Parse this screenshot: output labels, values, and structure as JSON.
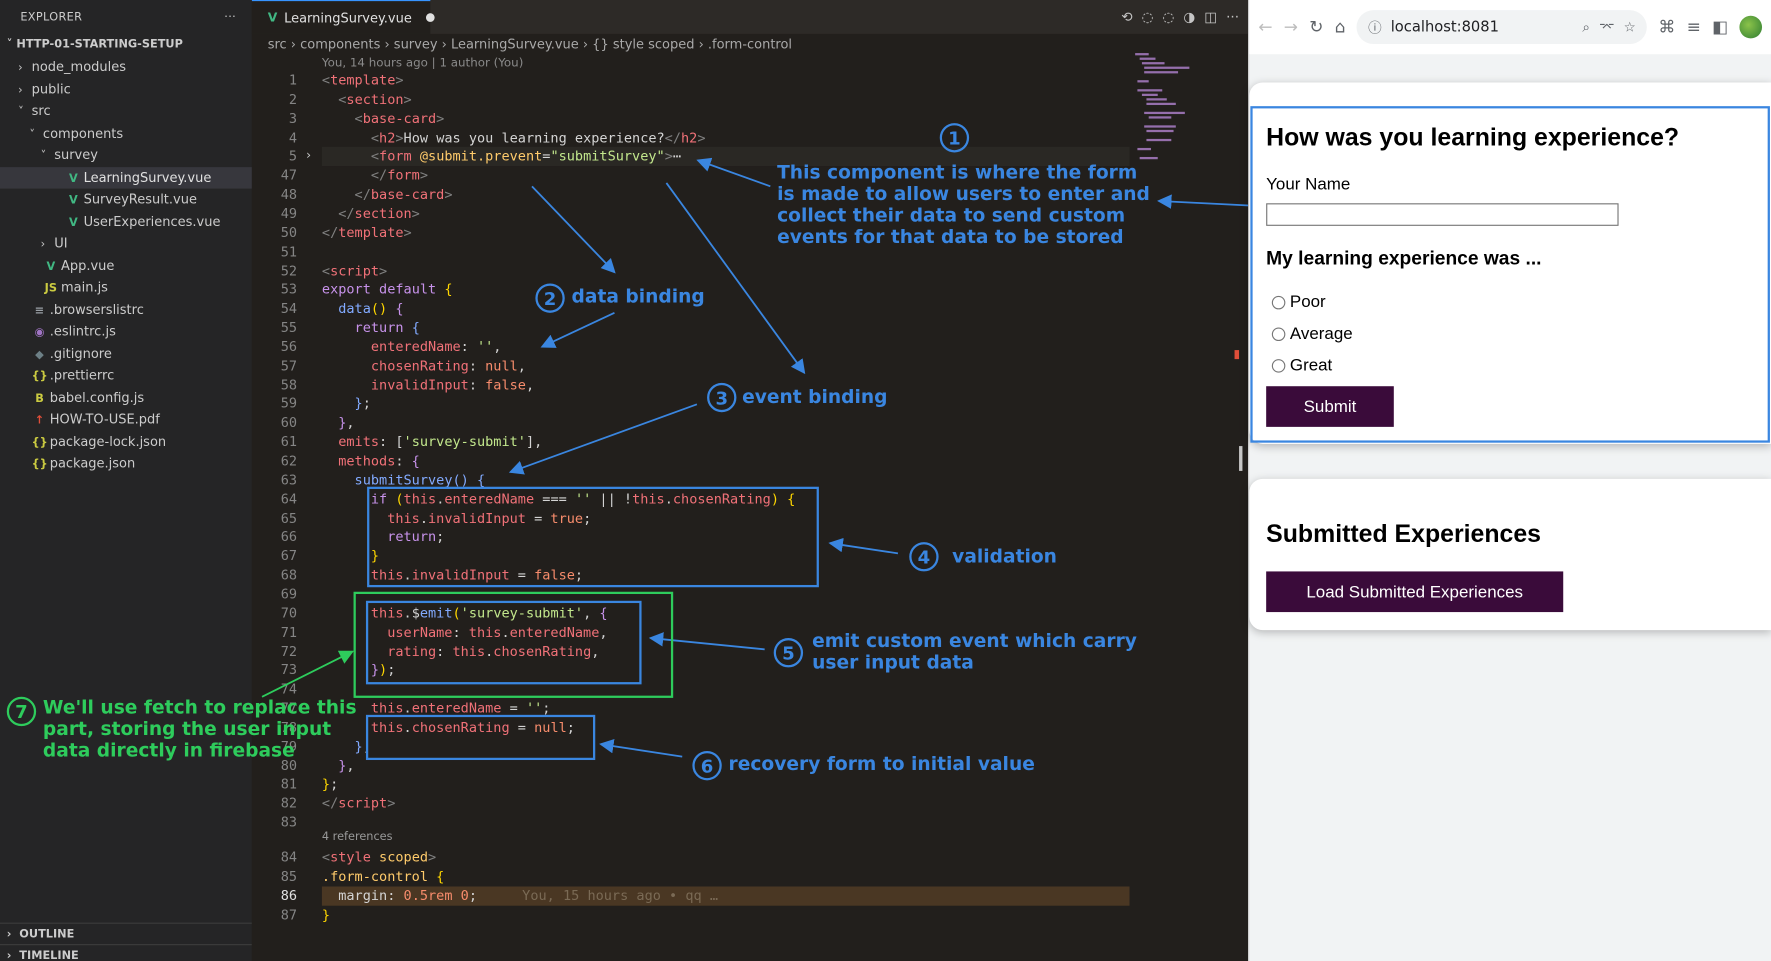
{
  "explorer": {
    "title": "EXPLORER",
    "menu": "···",
    "project": "HTTP-01-STARTING-SETUP",
    "items": [
      {
        "label": "node_modules",
        "indent": 1,
        "chev": "›",
        "icon": "",
        "color": "#cccccc"
      },
      {
        "label": "public",
        "indent": 1,
        "chev": "›",
        "icon": "",
        "color": "#cccccc"
      },
      {
        "label": "src",
        "indent": 1,
        "chev": "˅",
        "icon": "",
        "color": "#cccccc"
      },
      {
        "label": "components",
        "indent": 2,
        "chev": "˅",
        "icon": "",
        "color": "#cccccc"
      },
      {
        "label": "survey",
        "indent": 3,
        "chev": "˅",
        "icon": "",
        "color": "#cccccc"
      },
      {
        "label": "LearningSurvey.vue",
        "indent": 4,
        "chev": "",
        "icon": "V",
        "iconColor": "#41b883",
        "color": "#e0e0e0",
        "selected": true
      },
      {
        "label": "SurveyResult.vue",
        "indent": 4,
        "chev": "",
        "icon": "V",
        "iconColor": "#41b883",
        "color": "#cccccc"
      },
      {
        "label": "UserExperiences.vue",
        "indent": 4,
        "chev": "",
        "icon": "V",
        "iconColor": "#41b883",
        "color": "#cccccc"
      },
      {
        "label": "UI",
        "indent": 3,
        "chev": "›",
        "icon": "",
        "color": "#cccccc"
      },
      {
        "label": "App.vue",
        "indent": 2,
        "chev": "",
        "icon": "V",
        "iconColor": "#41b883",
        "color": "#cccccc"
      },
      {
        "label": "main.js",
        "indent": 2,
        "chev": "",
        "icon": "JS",
        "iconColor": "#cbcb41",
        "color": "#cccccc"
      },
      {
        "label": ".browserslistrc",
        "indent": 1,
        "chev": "",
        "icon": "≡",
        "iconColor": "#9aa0a6",
        "color": "#cccccc"
      },
      {
        "label": ".eslintrc.js",
        "indent": 1,
        "chev": "",
        "icon": "◉",
        "iconColor": "#a074c4",
        "color": "#cccccc"
      },
      {
        "label": ".gitignore",
        "indent": 1,
        "chev": "",
        "icon": "◆",
        "iconColor": "#6d8086",
        "color": "#cccccc"
      },
      {
        "label": ".prettierrc",
        "indent": 1,
        "chev": "",
        "icon": "{}",
        "iconColor": "#cbcb41",
        "color": "#cccccc"
      },
      {
        "label": "babel.config.js",
        "indent": 1,
        "chev": "",
        "icon": "B",
        "iconColor": "#cbcb41",
        "color": "#cccccc"
      },
      {
        "label": "HOW-TO-USE.pdf",
        "indent": 1,
        "chev": "",
        "icon": "↑",
        "iconColor": "#e04e39",
        "color": "#cccccc"
      },
      {
        "label": "package-lock.json",
        "indent": 1,
        "chev": "",
        "icon": "{}",
        "iconColor": "#cbcb41",
        "color": "#cccccc"
      },
      {
        "label": "package.json",
        "indent": 1,
        "chev": "",
        "icon": "{}",
        "iconColor": "#cbcb41",
        "color": "#cccccc"
      }
    ],
    "outline": "OUTLINE",
    "timeline": "TIMELINE"
  },
  "editor": {
    "tab_label": "LearningSurvey.vue",
    "tab_dirty": "●",
    "breadcrumb": "src  ›  components  ›  survey  ›  LearningSurvey.vue  ›  {} style scoped  ›  .form-control",
    "blame": "You, 14 hours ago | 1 author (You)",
    "codelens_refs": "4 references",
    "inline_blame": "You, 15 hours ago • qq …",
    "line_numbers": [
      "1",
      "2",
      "3",
      "4",
      "5",
      "47",
      "48",
      "49",
      "50",
      "51",
      "52",
      "53",
      "54",
      "55",
      "56",
      "57",
      "58",
      "59",
      "60",
      "61",
      "62",
      "63",
      "64",
      "65",
      "66",
      "67",
      "68",
      "69",
      "70",
      "71",
      "72",
      "73",
      "74",
      "77",
      "78",
      "79",
      "80",
      "81",
      "82",
      "83",
      "84",
      "85",
      "86",
      "87"
    ],
    "code_lines": [
      [
        [
          "t-br",
          "<"
        ],
        [
          "t-tag",
          "template"
        ],
        [
          "t-br",
          ">"
        ]
      ],
      [
        [
          "t-plain",
          "  "
        ],
        [
          "t-br",
          "<"
        ],
        [
          "t-tag",
          "section"
        ],
        [
          "t-br",
          ">"
        ]
      ],
      [
        [
          "t-plain",
          "    "
        ],
        [
          "t-br",
          "<"
        ],
        [
          "t-tag",
          "base-card"
        ],
        [
          "t-br",
          ">"
        ]
      ],
      [
        [
          "t-plain",
          "      "
        ],
        [
          "t-br",
          "<"
        ],
        [
          "t-tag",
          "h2"
        ],
        [
          "t-br",
          ">"
        ],
        [
          "t-plain",
          "How was you learning experience?"
        ],
        [
          "t-br",
          "</"
        ],
        [
          "t-tag",
          "h2"
        ],
        [
          "t-br",
          ">"
        ]
      ],
      [
        [
          "t-plain",
          "      "
        ],
        [
          "t-br",
          "<"
        ],
        [
          "t-tag",
          "form"
        ],
        [
          "t-plain",
          " "
        ],
        [
          "t-attr",
          "@submit.prevent"
        ],
        [
          "t-plain",
          "="
        ],
        [
          "t-str",
          "\"submitSurvey\""
        ],
        [
          "t-br",
          ">"
        ],
        [
          "t-plain",
          "⋯"
        ]
      ],
      [
        [
          "t-plain",
          "      "
        ],
        [
          "t-br",
          "</"
        ],
        [
          "t-tag",
          "form"
        ],
        [
          "t-br",
          ">"
        ]
      ],
      [
        [
          "t-plain",
          "    "
        ],
        [
          "t-br",
          "</"
        ],
        [
          "t-tag",
          "base-card"
        ],
        [
          "t-br",
          ">"
        ]
      ],
      [
        [
          "t-plain",
          "  "
        ],
        [
          "t-br",
          "</"
        ],
        [
          "t-tag",
          "section"
        ],
        [
          "t-br",
          ">"
        ]
      ],
      [
        [
          "t-br",
          "</"
        ],
        [
          "t-tag",
          "template"
        ],
        [
          "t-br",
          ">"
        ]
      ],
      [
        [
          "t-plain",
          ""
        ]
      ],
      [
        [
          "t-br",
          "<"
        ],
        [
          "t-tag",
          "script"
        ],
        [
          "t-br",
          ">"
        ]
      ],
      [
        [
          "t-kw",
          "export"
        ],
        [
          "t-plain",
          " "
        ],
        [
          "t-kw",
          "default"
        ],
        [
          "t-plain",
          " "
        ],
        [
          "t-y",
          "{"
        ]
      ],
      [
        [
          "t-plain",
          "  "
        ],
        [
          "t-fn",
          "data"
        ],
        [
          "t-y",
          "()"
        ],
        [
          "t-plain",
          " "
        ],
        [
          "t-kw",
          "{"
        ]
      ],
      [
        [
          "t-plain",
          "    "
        ],
        [
          "t-kw",
          "return"
        ],
        [
          "t-plain",
          " "
        ],
        [
          "t-fn",
          "{"
        ]
      ],
      [
        [
          "t-plain",
          "      "
        ],
        [
          "t-prop",
          "enteredName"
        ],
        [
          "t-plain",
          ": "
        ],
        [
          "t-str",
          "''"
        ],
        [
          "t-plain",
          ","
        ]
      ],
      [
        [
          "t-plain",
          "      "
        ],
        [
          "t-prop",
          "chosenRating"
        ],
        [
          "t-plain",
          ": "
        ],
        [
          "t-num",
          "null"
        ],
        [
          "t-plain",
          ","
        ]
      ],
      [
        [
          "t-plain",
          "      "
        ],
        [
          "t-prop",
          "invalidInput"
        ],
        [
          "t-plain",
          ": "
        ],
        [
          "t-num",
          "false"
        ],
        [
          "t-plain",
          ","
        ]
      ],
      [
        [
          "t-plain",
          "    "
        ],
        [
          "t-fn",
          "}"
        ],
        [
          "t-plain",
          ";"
        ]
      ],
      [
        [
          "t-plain",
          "  "
        ],
        [
          "t-kw",
          "}"
        ],
        [
          "t-plain",
          ","
        ]
      ],
      [
        [
          "t-plain",
          "  "
        ],
        [
          "t-prop",
          "emits"
        ],
        [
          "t-plain",
          ": ["
        ],
        [
          "t-str",
          "'survey-submit'"
        ],
        [
          "t-plain",
          "],"
        ]
      ],
      [
        [
          "t-plain",
          "  "
        ],
        [
          "t-prop",
          "methods"
        ],
        [
          "t-plain",
          ": "
        ],
        [
          "t-kw",
          "{"
        ]
      ],
      [
        [
          "t-plain",
          "    "
        ],
        [
          "t-fn",
          "submitSurvey"
        ],
        [
          "t-fn",
          "()"
        ],
        [
          "t-plain",
          " "
        ],
        [
          "t-fn",
          "{"
        ]
      ],
      [
        [
          "t-plain",
          "      "
        ],
        [
          "t-kw",
          "if"
        ],
        [
          "t-plain",
          " "
        ],
        [
          "t-y",
          "("
        ],
        [
          "t-this",
          "this"
        ],
        [
          "t-plain",
          "."
        ],
        [
          "t-prop",
          "enteredName"
        ],
        [
          "t-plain",
          " === "
        ],
        [
          "t-str",
          "''"
        ],
        [
          "t-plain",
          " || !"
        ],
        [
          "t-this",
          "this"
        ],
        [
          "t-plain",
          "."
        ],
        [
          "t-prop",
          "chosenRating"
        ],
        [
          "t-y",
          ")"
        ],
        [
          "t-plain",
          " "
        ],
        [
          "t-y",
          "{"
        ]
      ],
      [
        [
          "t-plain",
          "        "
        ],
        [
          "t-this",
          "this"
        ],
        [
          "t-plain",
          "."
        ],
        [
          "t-prop",
          "invalidInput"
        ],
        [
          "t-plain",
          " = "
        ],
        [
          "t-num",
          "true"
        ],
        [
          "t-plain",
          ";"
        ]
      ],
      [
        [
          "t-plain",
          "        "
        ],
        [
          "t-kw",
          "return"
        ],
        [
          "t-plain",
          ";"
        ]
      ],
      [
        [
          "t-plain",
          "      "
        ],
        [
          "t-y",
          "}"
        ]
      ],
      [
        [
          "t-plain",
          "      "
        ],
        [
          "t-this",
          "this"
        ],
        [
          "t-plain",
          "."
        ],
        [
          "t-prop",
          "invalidInput"
        ],
        [
          "t-plain",
          " = "
        ],
        [
          "t-num",
          "false"
        ],
        [
          "t-plain",
          ";"
        ]
      ],
      [
        [
          "t-plain",
          ""
        ]
      ],
      [
        [
          "t-plain",
          "      "
        ],
        [
          "t-this",
          "this"
        ],
        [
          "t-plain",
          ".$"
        ],
        [
          "t-fn",
          "emit"
        ],
        [
          "t-y",
          "("
        ],
        [
          "t-str",
          "'survey-submit'"
        ],
        [
          "t-plain",
          ", "
        ],
        [
          "t-kw",
          "{"
        ]
      ],
      [
        [
          "t-plain",
          "        "
        ],
        [
          "t-prop",
          "userName"
        ],
        [
          "t-plain",
          ": "
        ],
        [
          "t-this",
          "this"
        ],
        [
          "t-plain",
          "."
        ],
        [
          "t-prop",
          "enteredName"
        ],
        [
          "t-plain",
          ","
        ]
      ],
      [
        [
          "t-plain",
          "        "
        ],
        [
          "t-prop",
          "rating"
        ],
        [
          "t-plain",
          ": "
        ],
        [
          "t-this",
          "this"
        ],
        [
          "t-plain",
          "."
        ],
        [
          "t-prop",
          "chosenRating"
        ],
        [
          "t-plain",
          ","
        ]
      ],
      [
        [
          "t-plain",
          "      "
        ],
        [
          "t-kw",
          "}"
        ],
        [
          "t-y",
          ")"
        ],
        [
          "t-plain",
          ";"
        ]
      ],
      [
        [
          "t-plain",
          ""
        ]
      ],
      [
        [
          "t-plain",
          "      "
        ],
        [
          "t-this",
          "this"
        ],
        [
          "t-plain",
          "."
        ],
        [
          "t-prop",
          "enteredName"
        ],
        [
          "t-plain",
          " = "
        ],
        [
          "t-str",
          "''"
        ],
        [
          "t-plain",
          ";"
        ]
      ],
      [
        [
          "t-plain",
          "      "
        ],
        [
          "t-this",
          "this"
        ],
        [
          "t-plain",
          "."
        ],
        [
          "t-prop",
          "chosenRating"
        ],
        [
          "t-plain",
          " = "
        ],
        [
          "t-num",
          "null"
        ],
        [
          "t-plain",
          ";"
        ]
      ],
      [
        [
          "t-plain",
          "    "
        ],
        [
          "t-fn",
          "}"
        ],
        [
          "t-plain",
          ","
        ]
      ],
      [
        [
          "t-plain",
          "  "
        ],
        [
          "t-kw",
          "}"
        ],
        [
          "t-plain",
          ","
        ]
      ],
      [
        [
          "t-y",
          "}"
        ],
        [
          "t-plain",
          ";"
        ]
      ],
      [
        [
          "t-br",
          "</"
        ],
        [
          "t-tag",
          "script"
        ],
        [
          "t-br",
          ">"
        ]
      ],
      [
        [
          "t-plain",
          ""
        ]
      ],
      [
        [
          "t-br",
          "<"
        ],
        [
          "t-tag",
          "style"
        ],
        [
          "t-plain",
          " "
        ],
        [
          "t-attr",
          "scoped"
        ],
        [
          "t-br",
          ">"
        ]
      ],
      [
        [
          "t-sel",
          ".form-control"
        ],
        [
          "t-plain",
          " "
        ],
        [
          "t-y",
          "{"
        ]
      ],
      [
        [
          "t-plain",
          "  "
        ],
        [
          "t-plain",
          "margin"
        ],
        [
          "t-plain",
          ": "
        ],
        [
          "t-num",
          "0.5rem 0"
        ],
        [
          "t-plain",
          ";"
        ]
      ],
      [
        [
          "t-y",
          "}"
        ]
      ],
      [
        [
          "t-plain",
          ""
        ]
      ]
    ]
  },
  "annotations": {
    "n1": "1",
    "n2": "2",
    "n3": "3",
    "n4": "4",
    "n5": "5",
    "n6": "6",
    "n7": "7",
    "a1": "This component is where the form is made to allow users to enter and collect their data to send custom events for that data to be stored",
    "a2": "data binding",
    "a3": "event binding",
    "a4": "validation",
    "a5": "emit custom event which carry user input data",
    "a6": "recovery form to initial value",
    "a7": "We'll use fetch to replace this part, storing the user input data directly in firebase"
  },
  "browser": {
    "url": "localhost:8081",
    "form_title": "How was you learning experience?",
    "name_label": "Your Name",
    "name_value": "",
    "rating_title": "My learning experience was ...",
    "options": [
      "Poor",
      "Average",
      "Great"
    ],
    "submit_label": "Submit",
    "submitted_title": "Submitted Experiences",
    "load_label": "Load Submitted Experiences"
  }
}
